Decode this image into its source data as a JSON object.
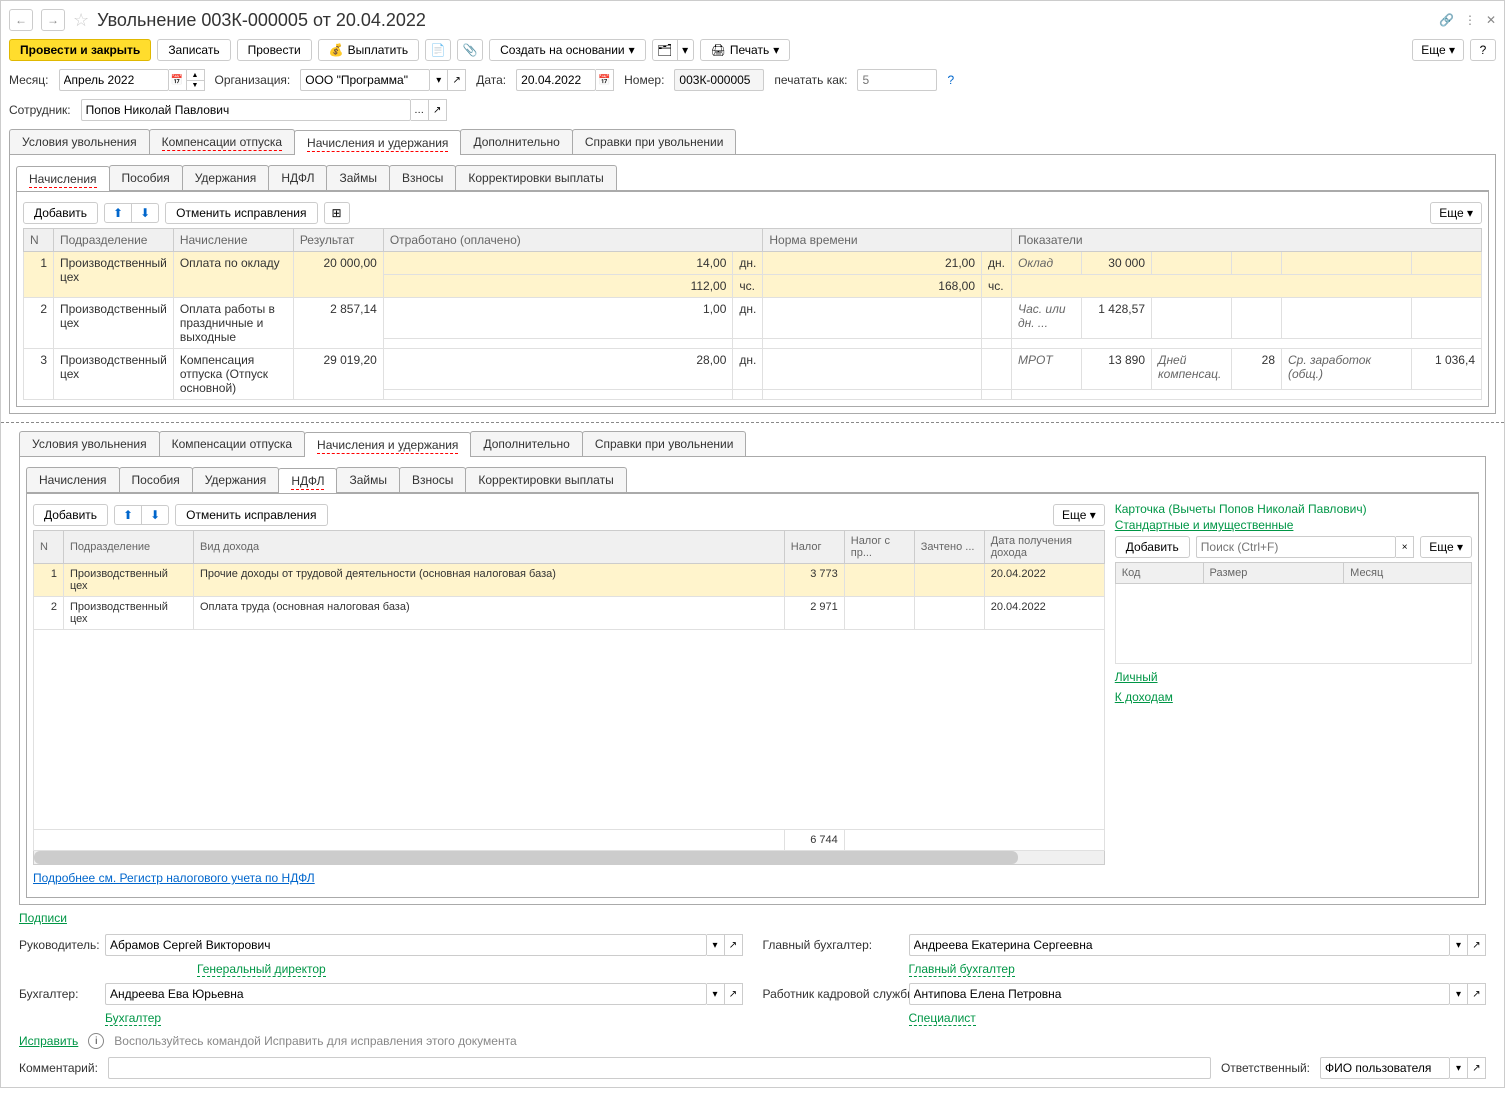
{
  "title": "Увольнение 003К-000005 от 20.04.2022",
  "tb": {
    "post_close": "Провести и закрыть",
    "write": "Записать",
    "post": "Провести",
    "pay": "Выплатить",
    "create_base": "Создать на основании",
    "print": "Печать",
    "more": "Еще",
    "help": "?"
  },
  "f": {
    "month_l": "Месяц:",
    "month": "Апрель 2022",
    "org_l": "Организация:",
    "org": "ООО \"Программа\"",
    "date_l": "Дата:",
    "date": "20.04.2022",
    "num_l": "Номер:",
    "num": "003К-000005",
    "print_as_l": "печатать как:",
    "print_as": "5",
    "emp_l": "Сотрудник:",
    "emp": "Попов Николай Павлович"
  },
  "tabs1": [
    "Условия увольнения",
    "Компенсации отпуска",
    "Начисления и удержания",
    "Дополнительно",
    "Справки при увольнении"
  ],
  "tabs1_active": 2,
  "sub1": [
    "Начисления",
    "Пособия",
    "Удержания",
    "НДФЛ",
    "Займы",
    "Взносы",
    "Корректировки выплаты"
  ],
  "sub1_active": 0,
  "tbtn": {
    "add": "Добавить",
    "cancel_fix": "Отменить исправления",
    "more": "Еще"
  },
  "t1": {
    "cols": [
      "N",
      "Подразделение",
      "Начисление",
      "Результат",
      "Отработано (оплачено)",
      "",
      "Норма времени",
      "",
      "Показатели",
      "",
      "",
      "",
      "",
      ""
    ],
    "rows": [
      {
        "n": "1",
        "dep": "Производственный цех",
        "acc": "Оплата по окладу",
        "res": "20 000,00",
        "w1": "14,00",
        "u1": "дн.",
        "w2": "112,00",
        "u2": "чс.",
        "n1": "21,00",
        "nu1": "дн.",
        "n2": "168,00",
        "nu2": "чс.",
        "p1": "Оклад",
        "pv1": "30 000",
        "p2": "",
        "pv2": "",
        "p3": "",
        "pv3": "",
        "sel": true
      },
      {
        "n": "2",
        "dep": "Производственный цех",
        "acc": "Оплата работы в праздничные и выходные",
        "res": "2 857,14",
        "w1": "1,00",
        "u1": "дн.",
        "w2": "",
        "u2": "",
        "n1": "",
        "nu1": "",
        "n2": "",
        "nu2": "",
        "p1": "Час. или дн. ...",
        "pv1": "1 428,57",
        "p2": "",
        "pv2": "",
        "p3": "",
        "pv3": ""
      },
      {
        "n": "3",
        "dep": "Производственный цех",
        "acc": "Компенсация отпуска (Отпуск основной)",
        "res": "29 019,20",
        "w1": "28,00",
        "u1": "дн.",
        "w2": "",
        "u2": "",
        "n1": "",
        "nu1": "",
        "n2": "",
        "nu2": "",
        "p1": "МРОТ",
        "pv1": "13 890",
        "p2": "Дней компенсац.",
        "pv2": "28",
        "p3": "Ср. заработок (общ.)",
        "pv3": "1 036,4"
      }
    ]
  },
  "sub2": [
    "Начисления",
    "Пособия",
    "Удержания",
    "НДФЛ",
    "Займы",
    "Взносы",
    "Корректировки выплаты"
  ],
  "sub2_active": 3,
  "t2": {
    "cols": [
      "N",
      "Подразделение",
      "Вид дохода",
      "Налог",
      "Налог с пр...",
      "Зачтено ...",
      "Дата получения дохода"
    ],
    "rows": [
      {
        "n": "1",
        "dep": "Производственный цех",
        "kind": "Прочие доходы от трудовой деятельности (основная налоговая база)",
        "tax": "3 773",
        "taxp": "",
        "z": "",
        "date": "20.04.2022",
        "sel": true
      },
      {
        "n": "2",
        "dep": "Производственный цех",
        "kind": "Оплата труда (основная налоговая база)",
        "tax": "2 971",
        "taxp": "",
        "z": "",
        "date": "20.04.2022"
      }
    ],
    "total": "6 744"
  },
  "t2_link": "Подробнее см. Регистр налогового учета по НДФЛ",
  "card": {
    "title": "Карточка (Вычеты Попов Николай Павлович)",
    "std": "Стандартные и имущественные",
    "add": "Добавить",
    "search_ph": "Поиск (Ctrl+F)",
    "more": "Еще",
    "cols": [
      "Код",
      "Размер",
      "Месяц"
    ],
    "personal": "Личный",
    "to_income": "К доходам"
  },
  "sig": {
    "title": "Подписи",
    "r1": "Руководитель:",
    "r1v": "Абрамов Сергей Викторович",
    "r1p": "Генеральный директор",
    "r2": "Главный бухгалтер:",
    "r2v": "Андреева Екатерина Сергеевна",
    "r2p": "Главный бухгалтер",
    "r3": "Бухгалтер:",
    "r3v": "Андреева Ева Юрьевна",
    "r3p": "Бухгалтер",
    "r4": "Работник кадровой службы:",
    "r4v": "Антипова Елена Петровна",
    "r4p": "Специалист"
  },
  "fix": {
    "link": "Исправить",
    "hint": "Воспользуйтесь командой Исправить для исправления этого документа"
  },
  "bot": {
    "comment_l": "Комментарий:",
    "resp_l": "Ответственный:",
    "resp": "ФИО пользователя"
  }
}
